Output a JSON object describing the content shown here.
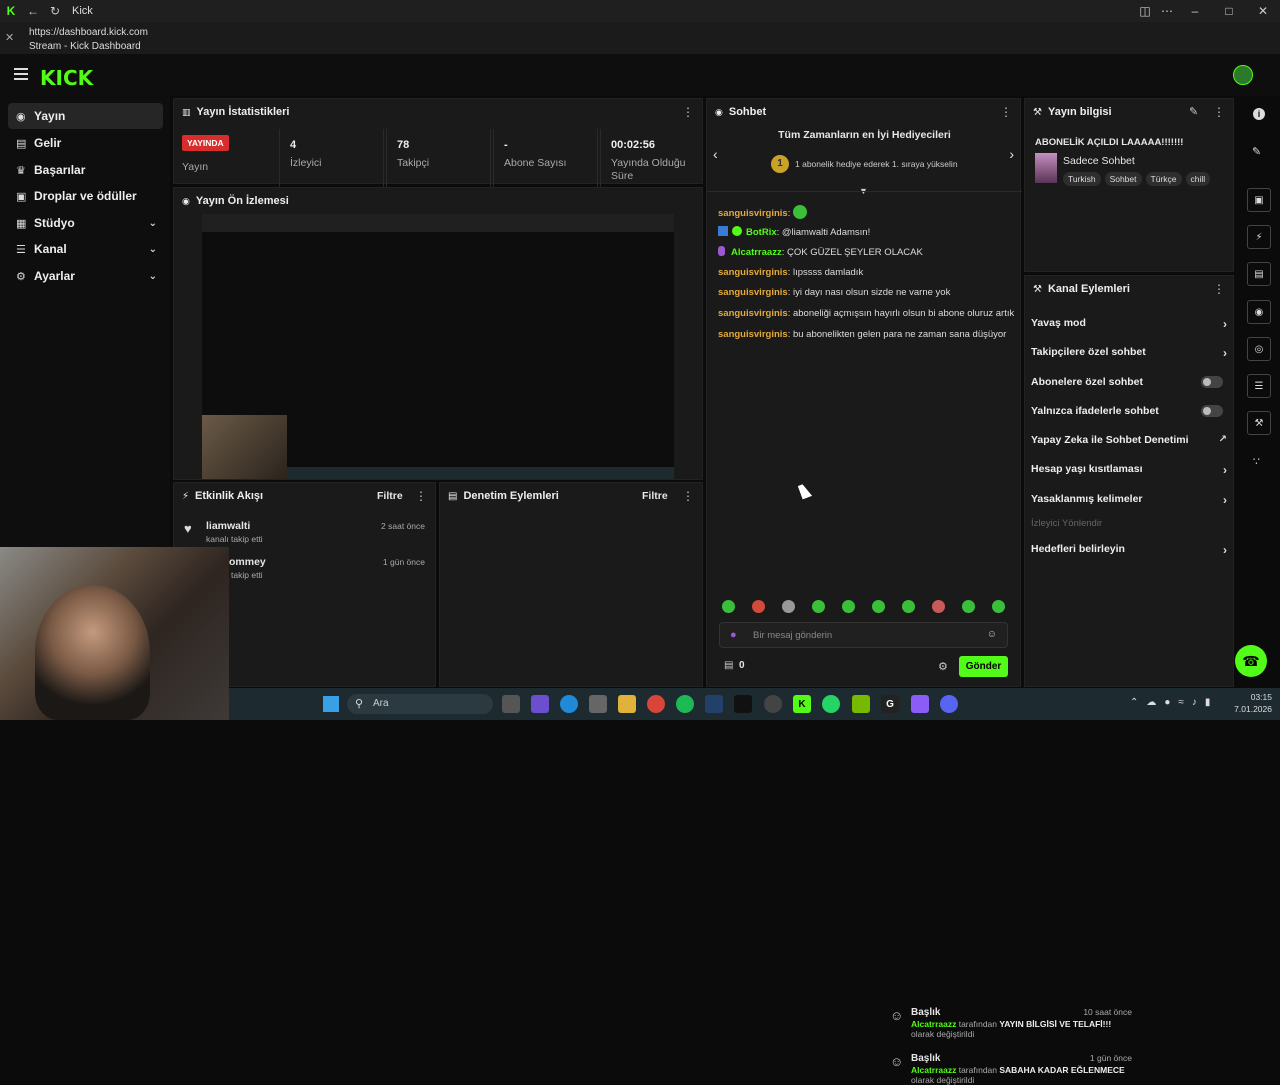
{
  "browser": {
    "tab_title": "Kick",
    "url": "https://dashboard.kick.com",
    "page_title": "Stream - Kick Dashboard"
  },
  "header": {
    "logo_text": "KICK"
  },
  "sidebar": {
    "items": [
      {
        "label": "Yayın",
        "icon": "broadcast-icon",
        "expandable": false
      },
      {
        "label": "Gelir",
        "icon": "money-icon",
        "expandable": false
      },
      {
        "label": "Başarılar",
        "icon": "trophy-icon",
        "expandable": false
      },
      {
        "label": "Droplar ve ödüller",
        "icon": "gift-icon",
        "expandable": false
      },
      {
        "label": "Stüdyo",
        "icon": "studio-icon",
        "expandable": true
      },
      {
        "label": "Kanal",
        "icon": "channel-icon",
        "expandable": true
      },
      {
        "label": "Ayarlar",
        "icon": "gear-icon",
        "expandable": true
      }
    ]
  },
  "stream_stats": {
    "title": "Yayın İstatistikleri",
    "live_badge": "YAYINDA",
    "status_label": "Yayın",
    "stats": [
      {
        "value": "4",
        "label": "İzleyici"
      },
      {
        "value": "78",
        "label": "Takipçi"
      },
      {
        "value": "-",
        "label": "Abone Sayısı"
      },
      {
        "value": "00:02:56",
        "label": "Yayında Olduğu Süre"
      }
    ]
  },
  "preview": {
    "title": "Yayın Ön İzlemesi"
  },
  "activity": {
    "title": "Etkinlik Akışı",
    "filter": "Filtre",
    "items": [
      {
        "user": "liamwalti",
        "text": "kanalı takip etti",
        "time": "2 saat önce"
      },
      {
        "user": "ommey",
        "text": "kanalı takip etti",
        "time": "1 gün önce"
      }
    ]
  },
  "moderation": {
    "title": "Denetim Eylemleri",
    "filter": "Filtre",
    "items": [
      {
        "title": "Başlık",
        "user": "Alcatrraazz",
        "mid": " tarafından ",
        "value": "YAYIN BİLGİSİ VE TELAFİ!!!",
        "end": " olarak değiştirildi",
        "time": "10 saat önce"
      },
      {
        "title": "Başlık",
        "user": "Alcatrraazz",
        "mid": " tarafından ",
        "value": "SABAHA KADAR EĞLENMECE",
        "end": " olarak değiştirildi",
        "time": "1 gün önce"
      }
    ]
  },
  "chat": {
    "title": "Sohbet",
    "gifters_title": "Tüm Zamanların en İyi Hediyecileri",
    "gifters_rank": "1",
    "gifters_text": "1 abonelik hediye ederek 1. sıraya yükselin",
    "messages": [
      {
        "user": "sanguisvirginis",
        "color": "#e3a93c",
        "text": ""
      },
      {
        "user": "BotRix",
        "color": "#53fc18",
        "text": "@liamwalti Adamsın!"
      },
      {
        "user": "Alcatrraazz",
        "color": "#53fc18",
        "text": "ÇOK GÜZEL ŞEYLER OLACAK"
      },
      {
        "user": "sanguisvirginis",
        "color": "#e3a93c",
        "text": "lıpssss damladık"
      },
      {
        "user": "sanguisvirginis",
        "color": "#e3a93c",
        "text": "iyi dayı nası olsun sizde ne varne yok"
      },
      {
        "user": "sanguisvirginis",
        "color": "#e3a93c",
        "text": "aboneliği açmışsın hayırlı olsun bi abone oluruz artık"
      },
      {
        "user": "sanguisvirginis",
        "color": "#e3a93c",
        "text": "bu abonelikten gelen para ne zaman sana düşüyor"
      }
    ],
    "input_placeholder": "Bir mesaj gönderin",
    "points": "0",
    "send_label": "Gönder"
  },
  "stream_info": {
    "title": "Yayın bilgisi",
    "stream_title": "ABONELİK AÇILDI LAAAAA!!!!!!!",
    "category": "Sadece Sohbet",
    "tags": [
      "Turkish",
      "Sohbet",
      "Türkçe",
      "chill"
    ]
  },
  "channel_actions": {
    "title": "Kanal Eylemleri",
    "items": [
      {
        "label": "Yavaş mod",
        "control": "chevron"
      },
      {
        "label": "Takipçilere özel sohbet",
        "control": "chevron"
      },
      {
        "label": "Abonelere özel sohbet",
        "control": "toggle"
      },
      {
        "label": "Yalnızca ifadelerle sohbet",
        "control": "toggle"
      },
      {
        "label": "Yapay Zeka ile Sohbet Denetimi",
        "control": "external"
      },
      {
        "label": "Hesap yaşı kısıtlaması",
        "control": "chevron"
      },
      {
        "label": "Yasaklanmış kelimeler",
        "control": "chevron"
      },
      {
        "label": "İzleyici Yönlendir",
        "control": "disabled"
      },
      {
        "label": "Hedefleri belirleyin",
        "control": "chevron"
      }
    ]
  },
  "taskbar": {
    "search_placeholder": "Ara",
    "time": "03:15",
    "date": "7.01.2026"
  },
  "colors": {
    "accent": "#53fc18",
    "live": "#d82d2d",
    "username": "#e3a93c"
  }
}
